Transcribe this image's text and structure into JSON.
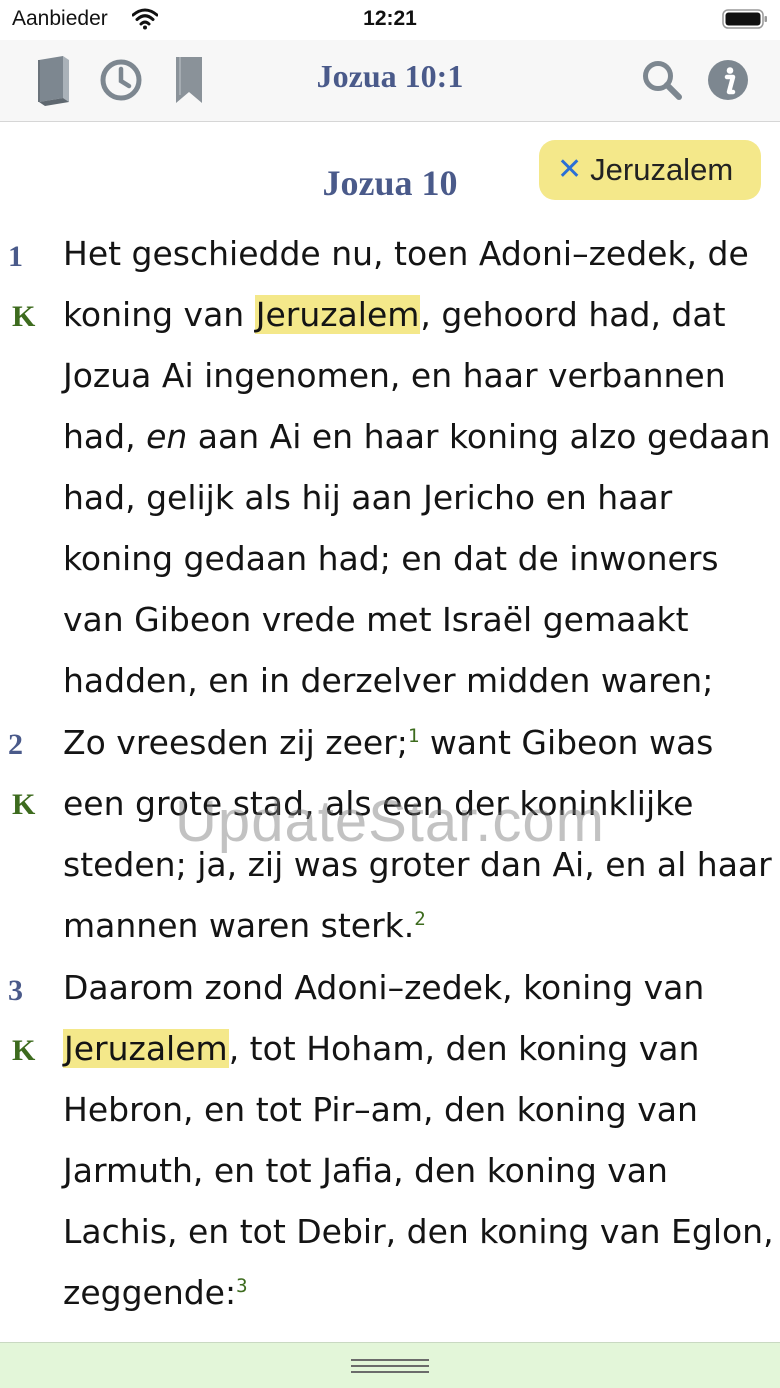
{
  "status_bar": {
    "carrier": "Aanbieder",
    "time": "12:21"
  },
  "toolbar": {
    "title": "Jozua 10:1",
    "icons": [
      "book-icon",
      "history-clock-icon",
      "bookmark-icon",
      "search-icon",
      "info-icon"
    ]
  },
  "chapter_title": "Jozua 10",
  "search_filter": {
    "label": "Jeruzalem",
    "close_icon": "close-icon"
  },
  "verses": [
    {
      "number": "1",
      "mark": "K",
      "text_before": "Het geschiedde nu, toen Adoni–zedek, de koning van ",
      "highlight": "Jeruzalem",
      "text_mid": ", gehoord had, dat Jozua Ai ingenomen, en haar verbannen had, ",
      "italic": "en",
      "text_after": " aan Ai en haar koning alzo gedaan had, gelijk als hij aan Jericho en haar koning gedaan had; en dat de inwoners van Gibeon vrede met Israël gemaakt hadden, en in derzelver midden waren;"
    },
    {
      "number": "2",
      "mark": "K",
      "text_before": "Zo vreesden zij zeer;",
      "footnote1": "1",
      "text_mid": " want Gibeon was een grote stad, als een der koninklijke steden; ja, zij was groter dan Ai, en al haar mannen waren sterk.",
      "footnote2": "2"
    },
    {
      "number": "3",
      "mark": "K",
      "text_before": "Daarom zond Adoni–zedek, koning van ",
      "highlight": "Jeruzalem",
      "text_after": ", tot Hoham, den koning van Hebron, en tot Pir–am, den koning van Jarmuth, en tot Jafia, den koning van Lachis, en tot Debir, den koning van Eglon, zeggende:",
      "footnote": "3"
    }
  ],
  "watermark": "UpdateStar.com",
  "colors": {
    "title": "#4a5a8a",
    "highlight": "#f4e88a",
    "mark_green": "#3d6b1e",
    "bottom_bar": "#e3f6d9",
    "toolbar_bg": "#f7f7f7"
  }
}
